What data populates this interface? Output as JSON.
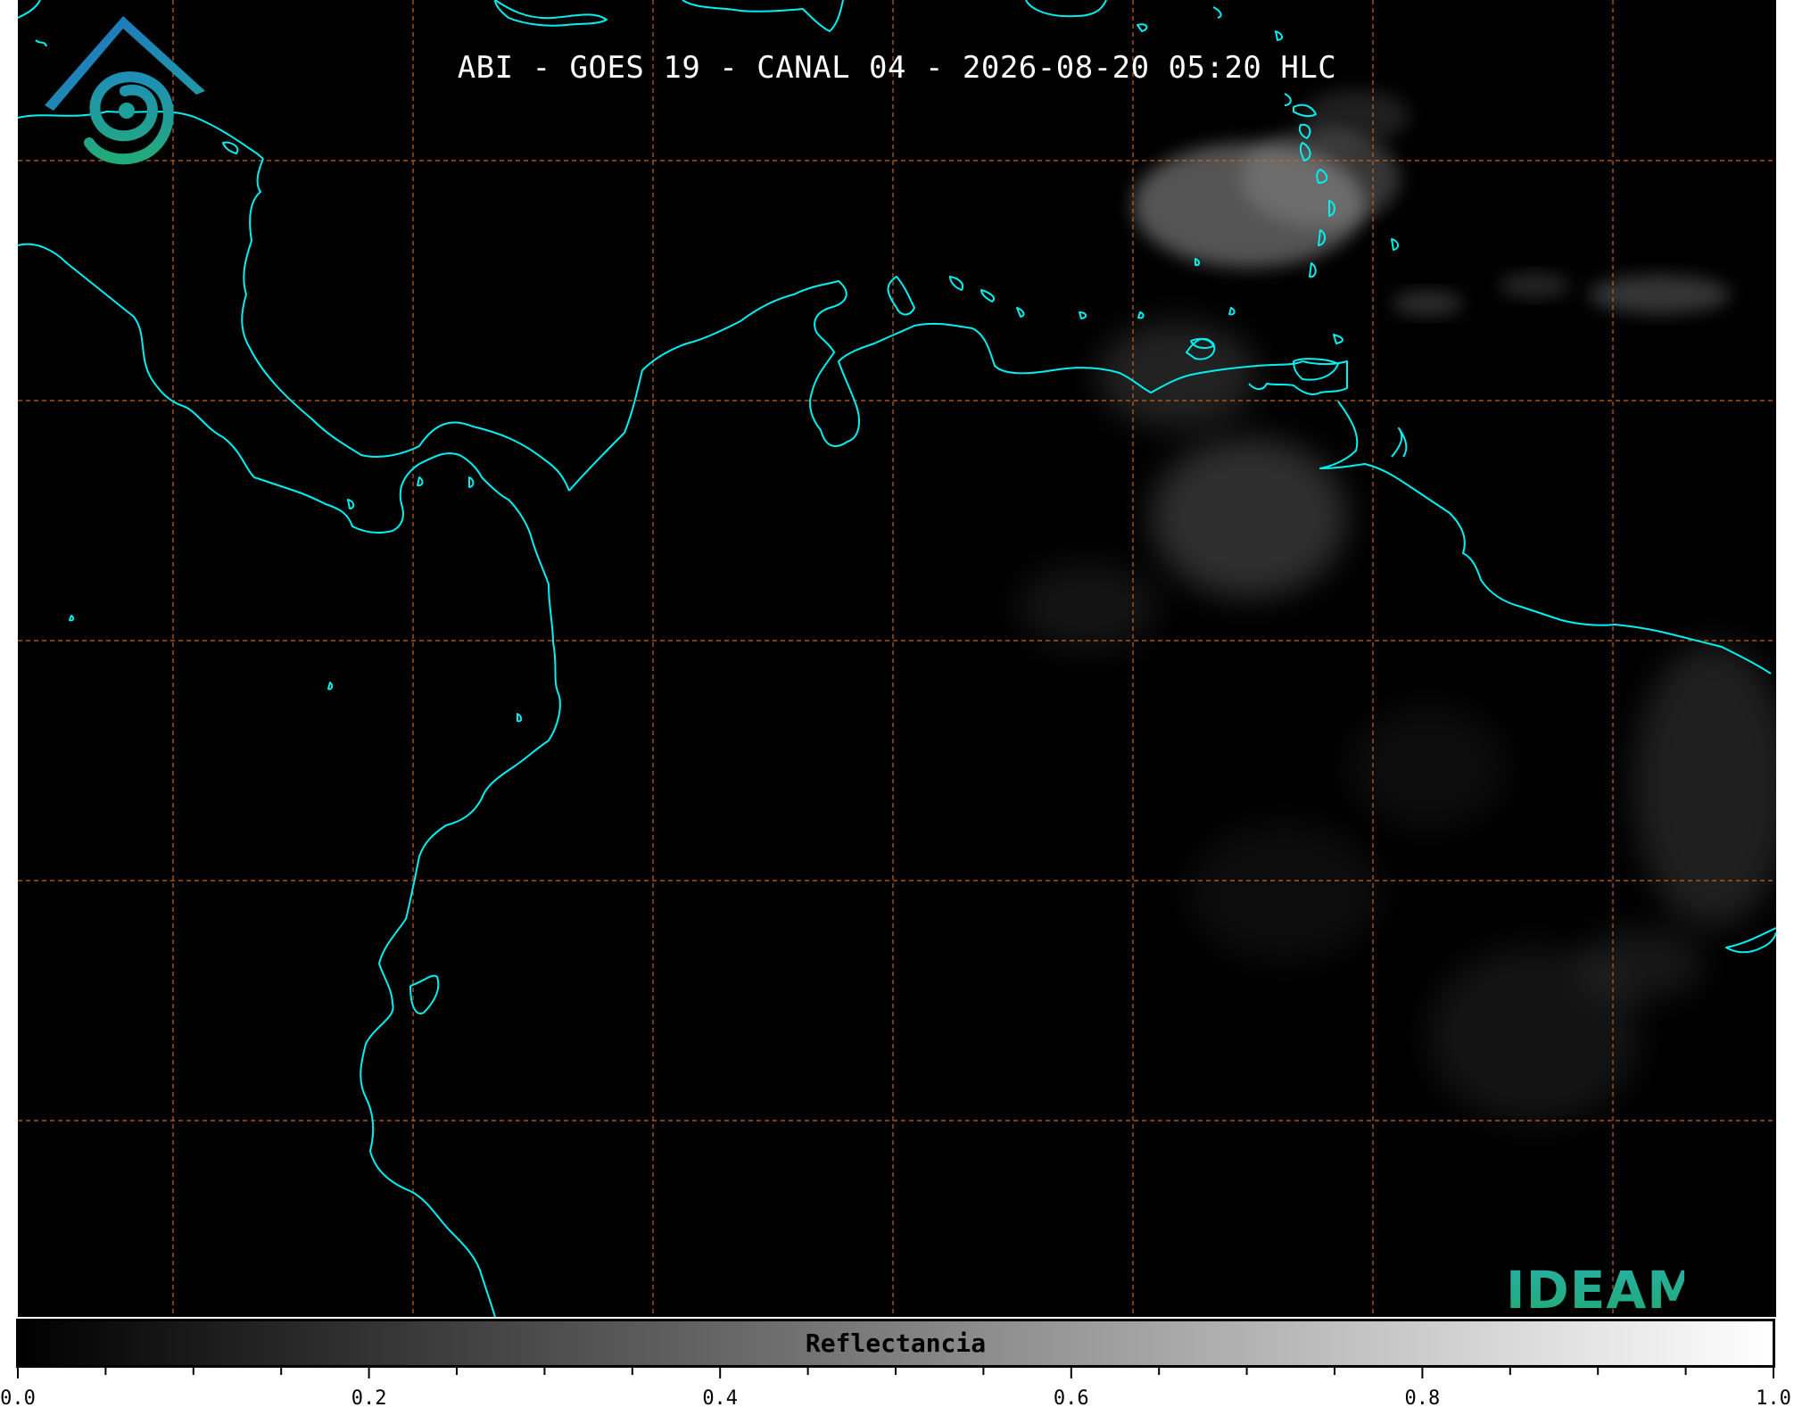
{
  "title": "ABI - GOES 19 - CANAL 04 - 2026-08-20 05:20 HLC",
  "logo": {
    "text": "IDEAM",
    "icon": "ideam-mountain-spiral-icon",
    "colors": {
      "roof": "#1f7fbf",
      "spiral": "#1fa88e",
      "text": "#22aa7a"
    }
  },
  "map": {
    "background": "#000000",
    "coastline_color": "#00f0f0",
    "graticule_color": "#c8641e",
    "cloud_color": "#9a9a9a"
  },
  "colorbar": {
    "label": "Reflectancia",
    "min": 0.0,
    "max": 1.0,
    "gradient": [
      "#000000",
      "#ffffff"
    ],
    "tick_labels": [
      "0.0",
      "0.2",
      "0.4",
      "0.6",
      "0.8",
      "1.0"
    ],
    "tick_values": [
      0.0,
      0.2,
      0.4,
      0.6,
      0.8,
      1.0
    ],
    "minor_step": 0.05
  }
}
